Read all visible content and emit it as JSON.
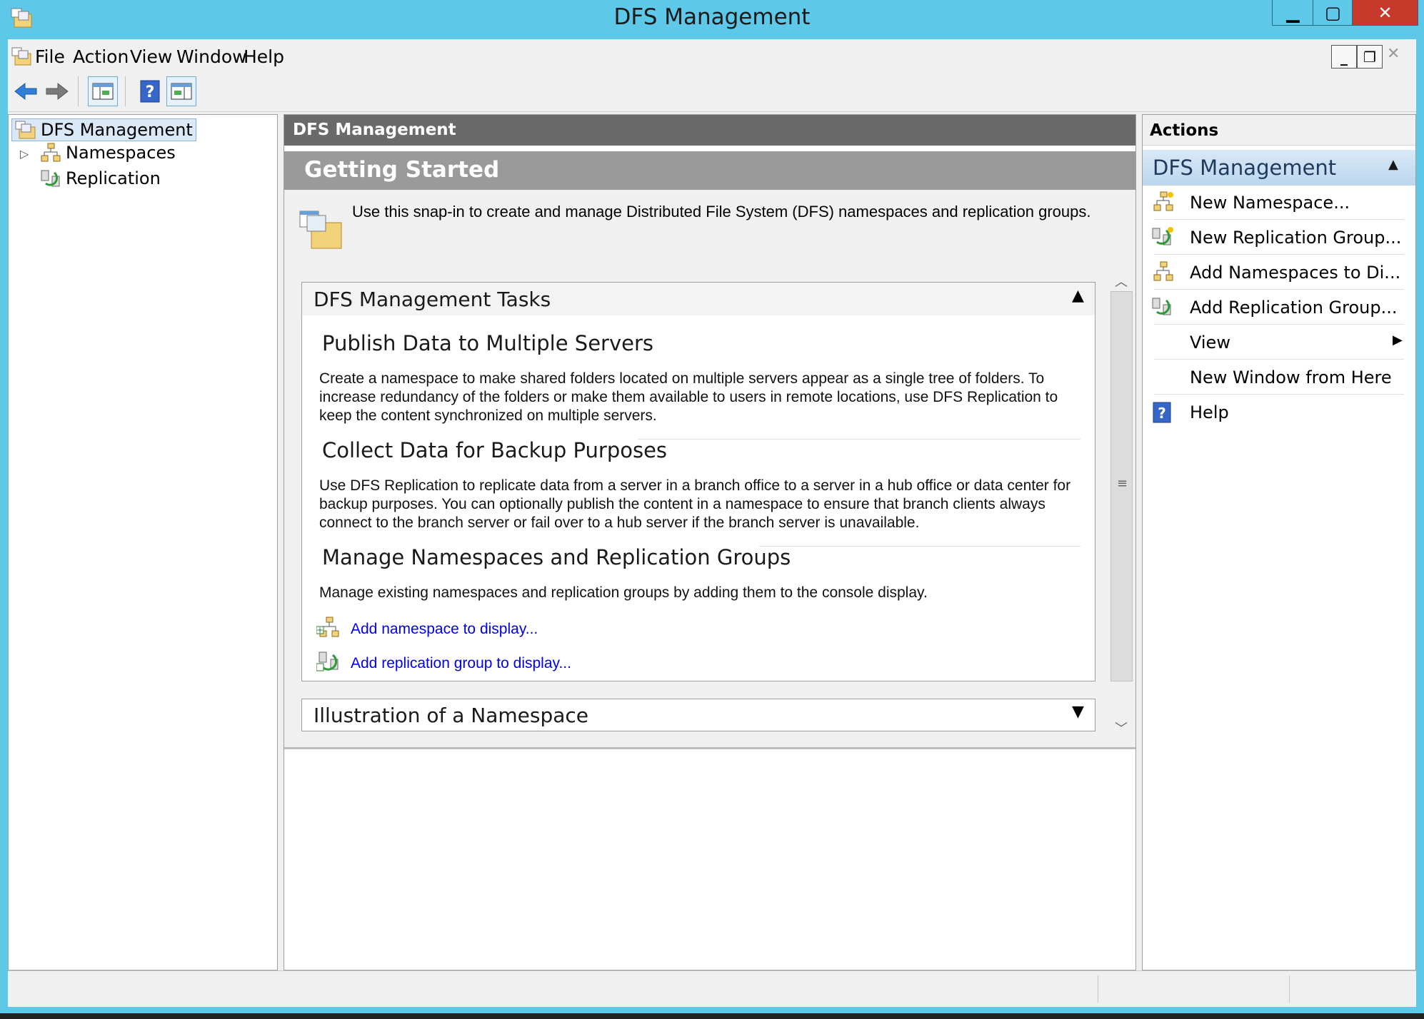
{
  "window": {
    "title": "DFS Management"
  },
  "menu": {
    "items": [
      "File",
      "Action",
      "View",
      "Window",
      "Help"
    ]
  },
  "tree": {
    "root": "DFS Management",
    "items": [
      "Namespaces",
      "Replication"
    ]
  },
  "center": {
    "header": "DFS Management",
    "getting_started": "Getting Started",
    "intro": "Use this snap-in to create and manage Distributed File System (DFS) namespaces and replication groups.",
    "tasks_panel": {
      "title": "DFS Management Tasks",
      "sections": [
        {
          "title": "Publish Data to Multiple Servers",
          "body": "Create a namespace to make shared folders located on multiple servers appear as a single tree of folders. To increase redundancy of the folders or make them available to users in remote locations, use DFS Replication to keep the content synchronized on multiple servers."
        },
        {
          "title": "Collect Data for Backup Purposes",
          "body": "Use DFS Replication to replicate data from a server in a branch office to a server in a hub office or data center for backup purposes. You can optionally publish the content in a namespace to ensure that branch clients always connect to the branch server or fail over to a hub server if the branch server is unavailable."
        },
        {
          "title": "Manage Namespaces and Replication Groups",
          "body": "Manage existing namespaces and replication groups by adding them to the console display."
        }
      ],
      "links": [
        "Add namespace to display...",
        "Add replication group to display..."
      ]
    },
    "illustration_panel": {
      "title": "Illustration of a Namespace"
    }
  },
  "actions": {
    "title": "Actions",
    "group": "DFS Management",
    "items": [
      "New Namespace...",
      "New Replication Group...",
      "Add Namespaces to Di...",
      "Add Replication Group...",
      "View",
      "New Window from Here",
      "Help"
    ]
  },
  "colors": {
    "title_bar": "#5dc8e8",
    "close_button": "#c7392b",
    "link": "#0000ee"
  }
}
